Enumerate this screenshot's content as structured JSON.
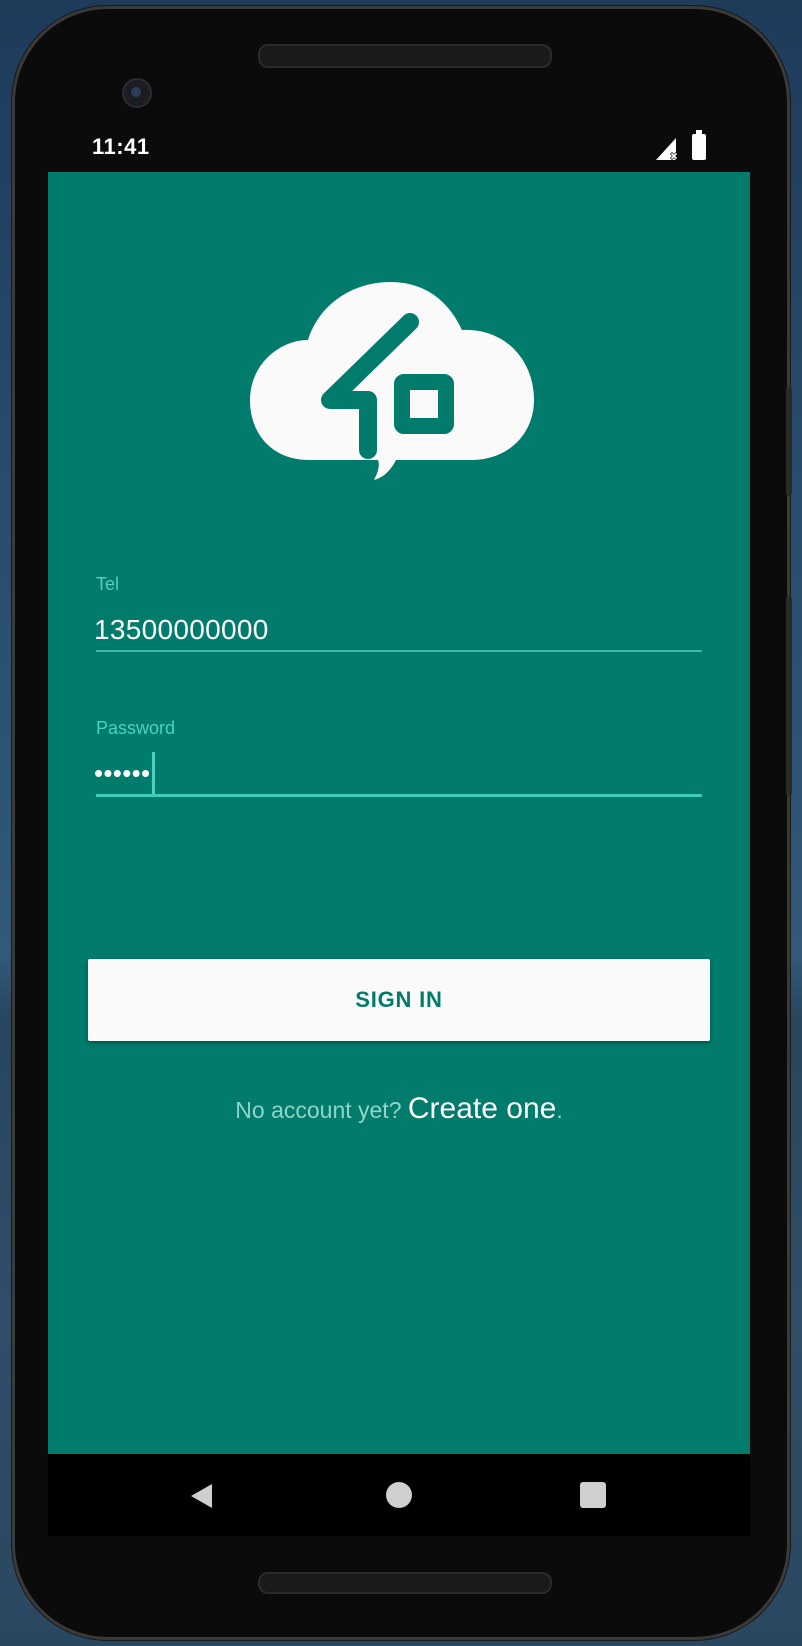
{
  "status_bar": {
    "time": "11:41",
    "signal_icon": "signal-no-service-icon",
    "battery_icon": "battery-full-icon"
  },
  "logo": {
    "icon": "cloud-chat-logo",
    "color": "#fafafa"
  },
  "tel_field": {
    "label": "Tel",
    "value": "13500000000"
  },
  "password_field": {
    "label": "Password",
    "value": "••••••"
  },
  "sign_in_button": {
    "label": "SIGN IN"
  },
  "footer": {
    "prompt": "No account yet? ",
    "link": "Create one",
    "suffix": "."
  },
  "nav_bar": {
    "back_icon": "back-triangle-icon",
    "home_icon": "home-circle-icon",
    "recents_icon": "recents-square-icon"
  },
  "colors": {
    "primary": "#017b6c",
    "accent": "#4dd2bf",
    "button_bg": "#fafafa"
  }
}
